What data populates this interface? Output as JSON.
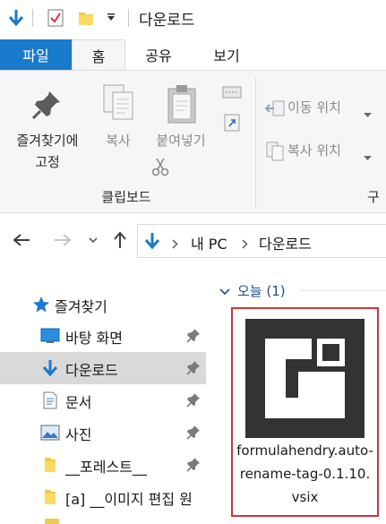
{
  "titlebar": {
    "title": "다운로드",
    "icons": [
      "down-arrow-icon",
      "properties-checklist-icon",
      "folder-icon",
      "dropdown-arrow-icon"
    ]
  },
  "ribbon_tabs": [
    {
      "label": "파일",
      "state": "file"
    },
    {
      "label": "홈",
      "state": "active"
    },
    {
      "label": "공유",
      "state": "normal"
    },
    {
      "label": "보기",
      "state": "normal"
    }
  ],
  "ribbon": {
    "pin_label_line1": "즐겨찾기에",
    "pin_label_line2": "고정",
    "copy_label": "복사",
    "paste_label": "붙여넣기",
    "group_label": "클립보드",
    "move_to_label": "이동 위치",
    "copy_to_label": "복사 위치",
    "cut_off_group_label": "구"
  },
  "addressbar": {
    "segments": [
      "내 PC",
      "다운로드"
    ]
  },
  "navpane": {
    "header": "즐겨찾기",
    "items": [
      {
        "label": "바탕 화면",
        "icon": "desktop-icon"
      },
      {
        "label": "다운로드",
        "icon": "download-arrow-icon",
        "selected": true
      },
      {
        "label": "문서",
        "icon": "document-icon"
      },
      {
        "label": "사진",
        "icon": "pictures-icon"
      },
      {
        "label": "__포레스트__",
        "icon": "folder-icon"
      },
      {
        "label": "[a] __이미지 편집 원",
        "icon": "folder-icon"
      }
    ]
  },
  "content": {
    "group_header": "오늘 (1)",
    "file": {
      "name": "formulahendry.auto-rename-tag-0.1.10.vsix"
    }
  },
  "colors": {
    "accent": "#1979ca",
    "ribbon_bg": "#f5f6f7",
    "selection_bg": "#d9d9d9",
    "tile_border": "#d13438",
    "thumb_bg": "#333333",
    "group_header": "#1e4e8c"
  }
}
